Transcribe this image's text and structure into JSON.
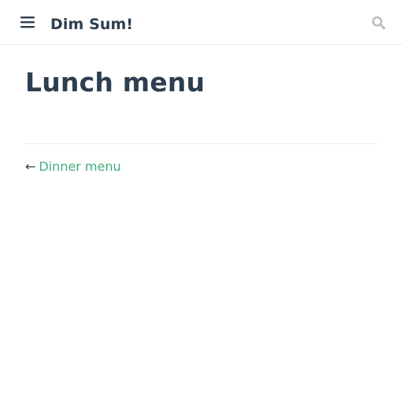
{
  "header": {
    "menu_icon": "hamburger-menu-icon",
    "site_title": "Dim Sum!",
    "search_icon": "search-icon"
  },
  "page": {
    "title": "Lunch menu"
  },
  "page_nav": {
    "prev_arrow": "←",
    "prev_label": "Dinner menu"
  },
  "colors": {
    "text": "#2c3e50",
    "accent": "#3eaf7c",
    "border": "#eaecef",
    "icon_muted": "#b8bec4"
  }
}
